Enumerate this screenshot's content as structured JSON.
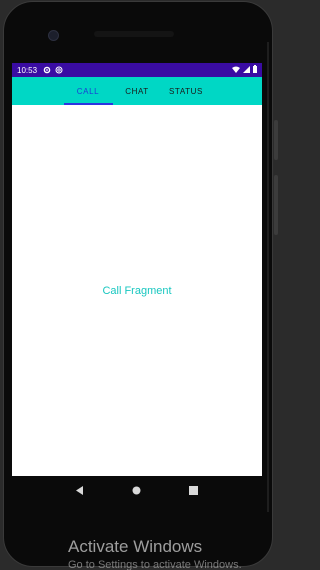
{
  "status_bar": {
    "time": "10:53",
    "icons": [
      "settings-icon",
      "at-icon",
      "wifi-icon",
      "signal-icon",
      "battery-icon"
    ]
  },
  "tabs": [
    {
      "label": "CALL",
      "active": true
    },
    {
      "label": "CHAT",
      "active": false
    },
    {
      "label": "STATUS",
      "active": false
    }
  ],
  "content": {
    "fragment_text": "Call Fragment"
  },
  "navigation": {
    "buttons": [
      "back-icon",
      "home-icon",
      "recents-icon"
    ]
  },
  "watermark": {
    "title": "Activate Windows",
    "subtitle": "Go to Settings to activate Windows."
  },
  "colors": {
    "status_bar": "#3a0ca3",
    "tab_bar": "#00d7c5",
    "active_tab_text": "#1a3ed6",
    "indicator": "#2d35e0",
    "fragment_text": "#19c7c0"
  }
}
